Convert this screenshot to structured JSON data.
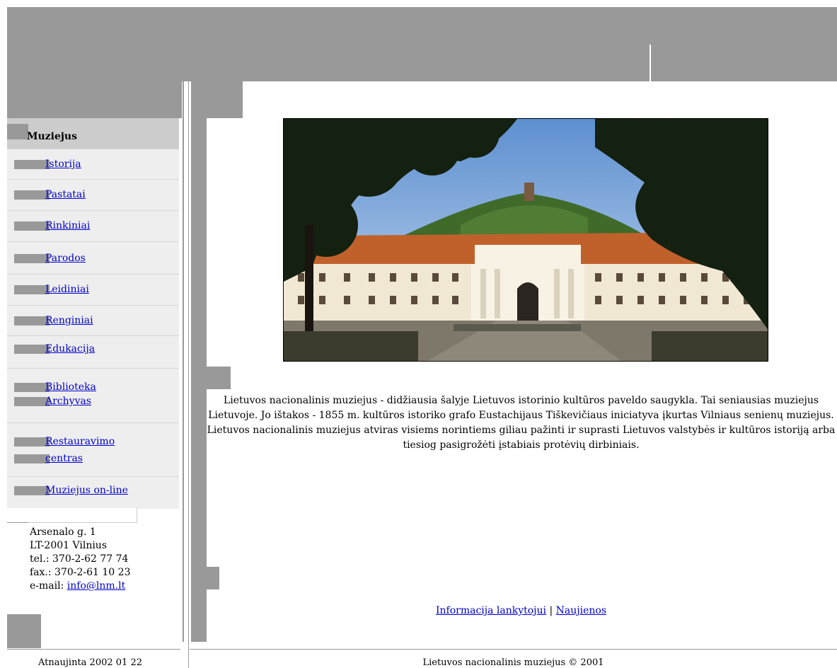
{
  "nav": {
    "header": "Muziejus",
    "items": [
      {
        "label": "Istorija"
      },
      {
        "label": "Pastatai"
      },
      {
        "label": "Rinkiniai"
      },
      {
        "label": "Parodos"
      },
      {
        "label": "Leidiniai"
      },
      {
        "label": "Renginiai"
      },
      {
        "label": "Edukacija"
      },
      {
        "label1": "Biblioteka",
        "label2": "Archyvas"
      },
      {
        "label1": "Restauravimo",
        "label2": "centras"
      },
      {
        "label": "Muziejus on-line"
      }
    ]
  },
  "address": {
    "street": "Arsenalo g. 1",
    "city": "LT-2001 Vilnius",
    "tel": "tel.: 370-2-62 77 74",
    "fax": "fax.: 370-2-61 10 23",
    "email_label": "e-mail: ",
    "email": "info@lnm.lt"
  },
  "main": {
    "description": "Lietuvos nacionalinis muziejus - didžiausia šalyje Lietuvos istorinio kultūros paveldo saugykla. Tai seniausias muziejus Lietuvoje. Jo ištakos - 1855 m. kultūros istoriko grafo Eustachijaus Tiškevičiaus iniciatyva įkurtas Vilniaus senienų muziejus. Lietuvos nacionalinis muziejus atviras visiems norintiems giliau pažinti ir suprasti Lietuvos valstybės ir kultūros istoriją arba tiesiog pasigrožėti įstabiais protėvių dirbiniais.",
    "link1": "Informacija lankytojui",
    "separator": "|",
    "link2": "Naujienos"
  },
  "footer": {
    "updated": "Atnaujinta 2002 01 22",
    "copyright": "Lietuvos nacionalinis muziejus © 2001"
  },
  "colors": {
    "gray_block": "#999999",
    "menu_bg": "#eeeeee",
    "menu_header_bg": "#cccccc",
    "link": "#0000cc"
  }
}
